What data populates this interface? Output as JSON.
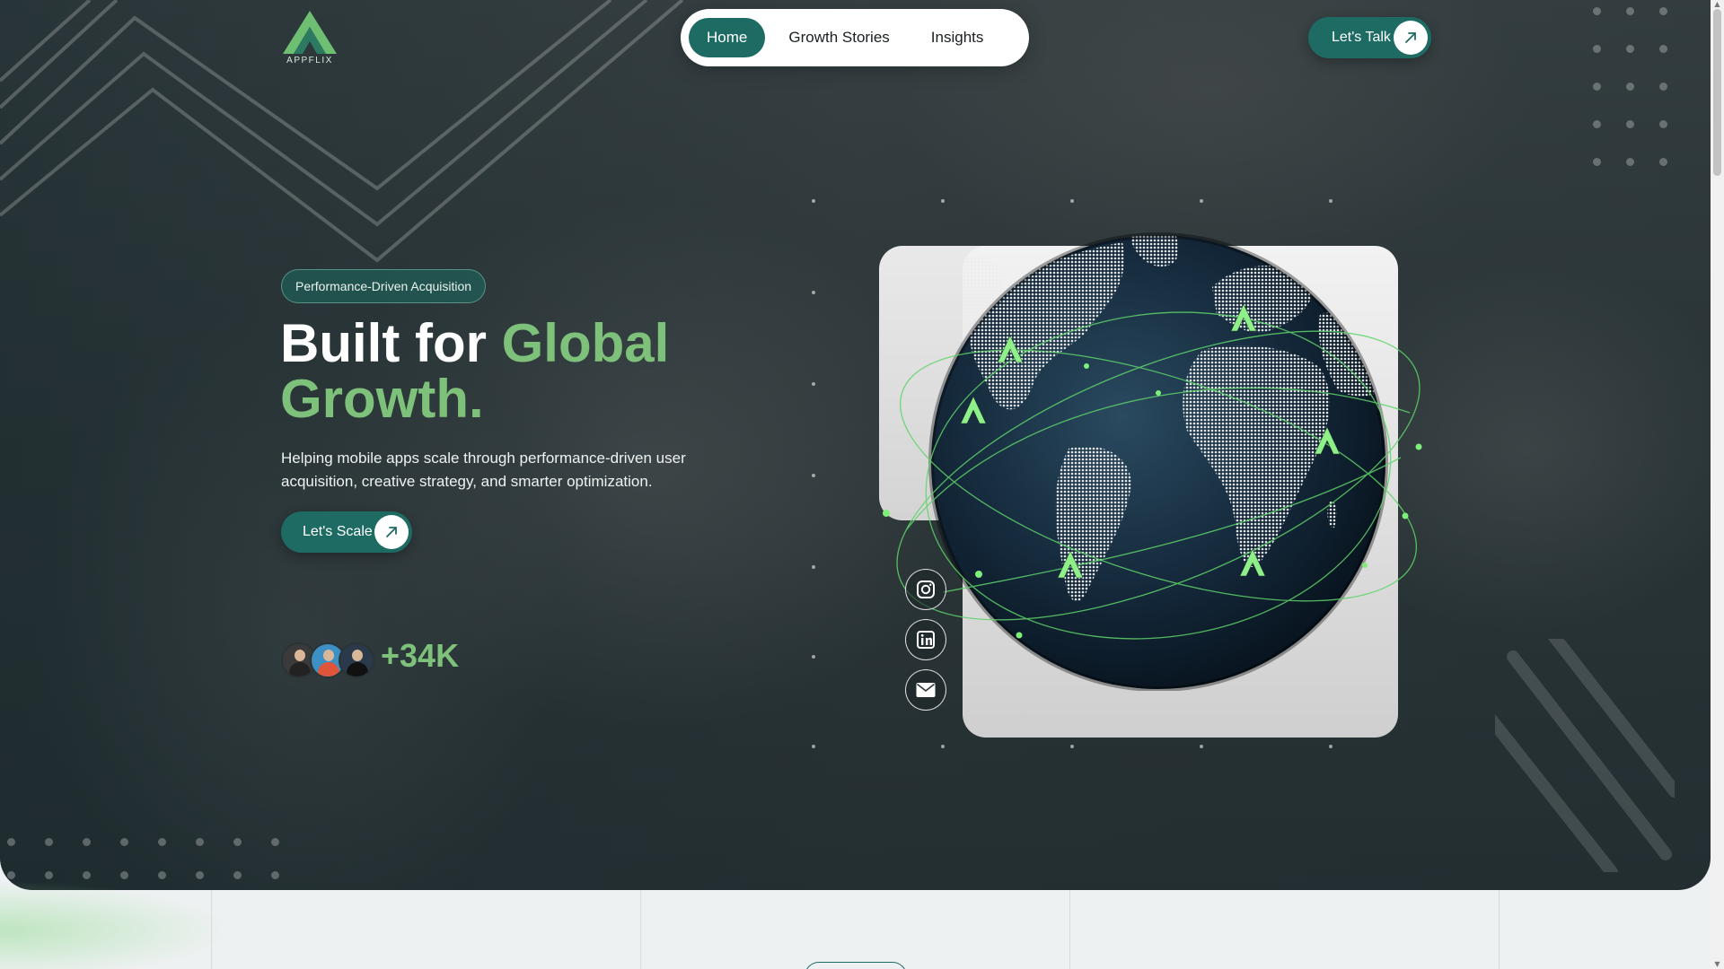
{
  "brand": {
    "logo_text": "APPFLIX"
  },
  "nav": {
    "items": [
      {
        "label": "Home",
        "active": true
      },
      {
        "label": "Growth Stories",
        "active": false
      },
      {
        "label": "Insights",
        "active": false
      }
    ],
    "cta_label": "Let's Talk"
  },
  "hero": {
    "badge": "Performance-Driven Acquisition",
    "headline_plain": "Built for ",
    "headline_accent": "Global Growth.",
    "subtext": "Helping mobile apps scale through performance-driven user acquisition, creative strategy, and smarter optimization.",
    "cta_label": "Let's Scale",
    "user_count": "+34K"
  },
  "social": [
    {
      "icon": "instagram-icon"
    },
    {
      "icon": "linkedin-icon"
    },
    {
      "icon": "mail-icon"
    }
  ],
  "colors": {
    "brand_green": "#1d6b62",
    "accent_green": "#7ec17a",
    "nav_bg": "#ffffff",
    "page_bg": "#eef1f2"
  }
}
